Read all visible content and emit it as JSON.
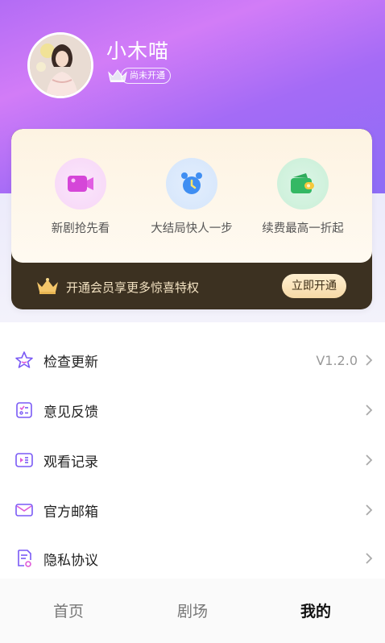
{
  "profile": {
    "username": "小木喵",
    "vip_status": "尚未开通"
  },
  "vip_card": {
    "features": [
      {
        "label": "新剧抢先看",
        "icon": "video-icon"
      },
      {
        "label": "大结局快人一步",
        "icon": "alarm-clock-icon"
      },
      {
        "label": "续费最高一折起",
        "icon": "wallet-icon"
      }
    ],
    "promo_text": "开通会员享更多惊喜特权",
    "open_button": "立即开通"
  },
  "menu": {
    "items": [
      {
        "label": "检查更新",
        "value": "V1.2.0",
        "icon": "star-icon"
      },
      {
        "label": "意见反馈",
        "value": "",
        "icon": "feedback-icon"
      },
      {
        "label": "观看记录",
        "value": "",
        "icon": "history-icon"
      },
      {
        "label": "官方邮箱",
        "value": "",
        "icon": "mail-icon"
      },
      {
        "label": "隐私协议",
        "value": "",
        "icon": "document-icon"
      }
    ]
  },
  "tabbar": {
    "tabs": [
      {
        "label": "首页",
        "active": false
      },
      {
        "label": "剧场",
        "active": false
      },
      {
        "label": "我的",
        "active": true
      }
    ]
  },
  "colors": {
    "header_gradient_start": "#b36cf5",
    "header_gradient_end": "#8d6cf6",
    "vip_dark": "#3c3121",
    "vip_gold": "#f6d9a6"
  }
}
